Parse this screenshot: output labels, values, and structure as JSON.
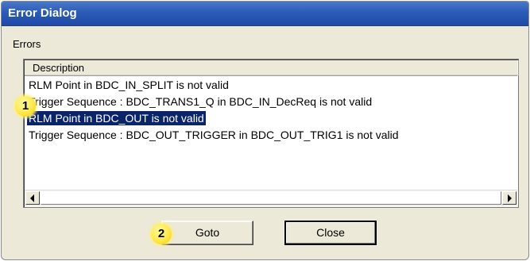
{
  "window": {
    "title": "Error Dialog"
  },
  "errors_group": {
    "label": "Errors",
    "column_header": "Description",
    "rows": [
      {
        "text": "RLM Point  in BDC_IN_SPLIT is not valid",
        "selected": false
      },
      {
        "text": "Trigger Sequence :  BDC_TRANS1_Q  in  BDC_IN_DecReq is not valid",
        "selected": false
      },
      {
        "text": "RLM Point  in BDC_OUT is not valid",
        "selected": true
      },
      {
        "text": "Trigger Sequence :  BDC_OUT_TRIGGER  in  BDC_OUT_TRIG1 is not valid",
        "selected": false
      }
    ]
  },
  "buttons": {
    "goto_label": "Goto",
    "close_label": "Close"
  },
  "callouts": {
    "one": "1",
    "two": "2"
  },
  "colors": {
    "titlebar": "#2b5bb8",
    "selection": "#0a246a",
    "dialog_bg": "#ece9d8",
    "callout": "#ffe84a"
  },
  "icons": {
    "scroll_left": "arrow-left-icon",
    "scroll_right": "arrow-right-icon"
  }
}
